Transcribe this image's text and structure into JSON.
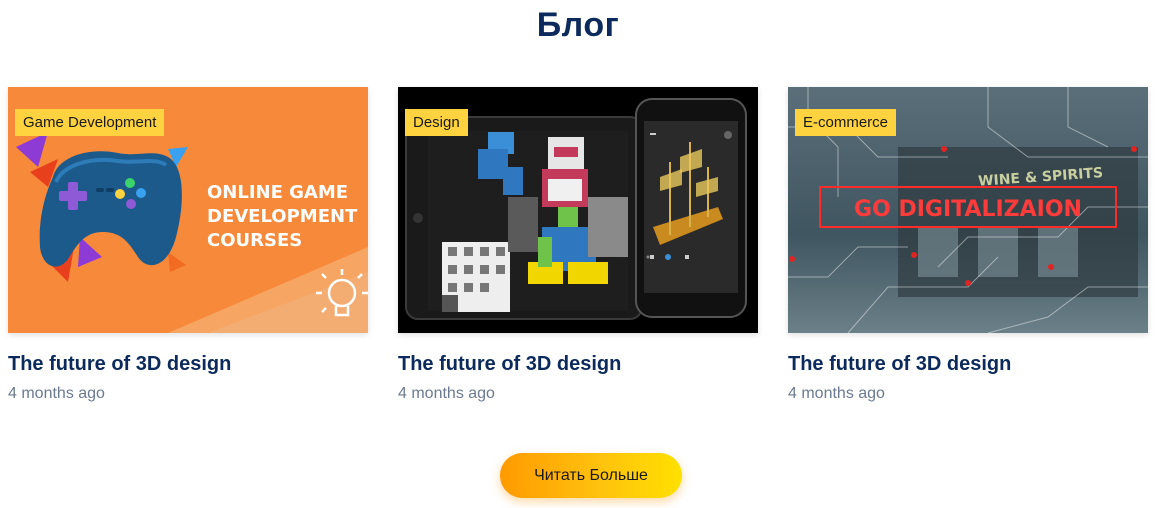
{
  "section": {
    "title": "Блог"
  },
  "cards": [
    {
      "tag": "Game Development",
      "title": "The future of 3D design",
      "date": "4 months ago",
      "image_text": [
        "ONLINE GAME",
        "DEVELOPMENT",
        "COURSES"
      ]
    },
    {
      "tag": "Design",
      "title": "The future of 3D design",
      "date": "4 months ago"
    },
    {
      "tag": "E-commerce",
      "title": "The future of 3D design",
      "date": "4 months ago",
      "image_text": [
        "GO DIGITALIZAION",
        "WINE & SPIRITS"
      ]
    }
  ],
  "actions": {
    "more_label": "Читать Больше"
  },
  "colors": {
    "heading": "#0c2a5b",
    "tag_bg": "#ffd23f",
    "accent_orange": "#f7893a",
    "button_from": "#ff9a00",
    "button_to": "#ffe000"
  },
  "icons": [
    "gamepad-icon",
    "lightbulb-icon"
  ]
}
